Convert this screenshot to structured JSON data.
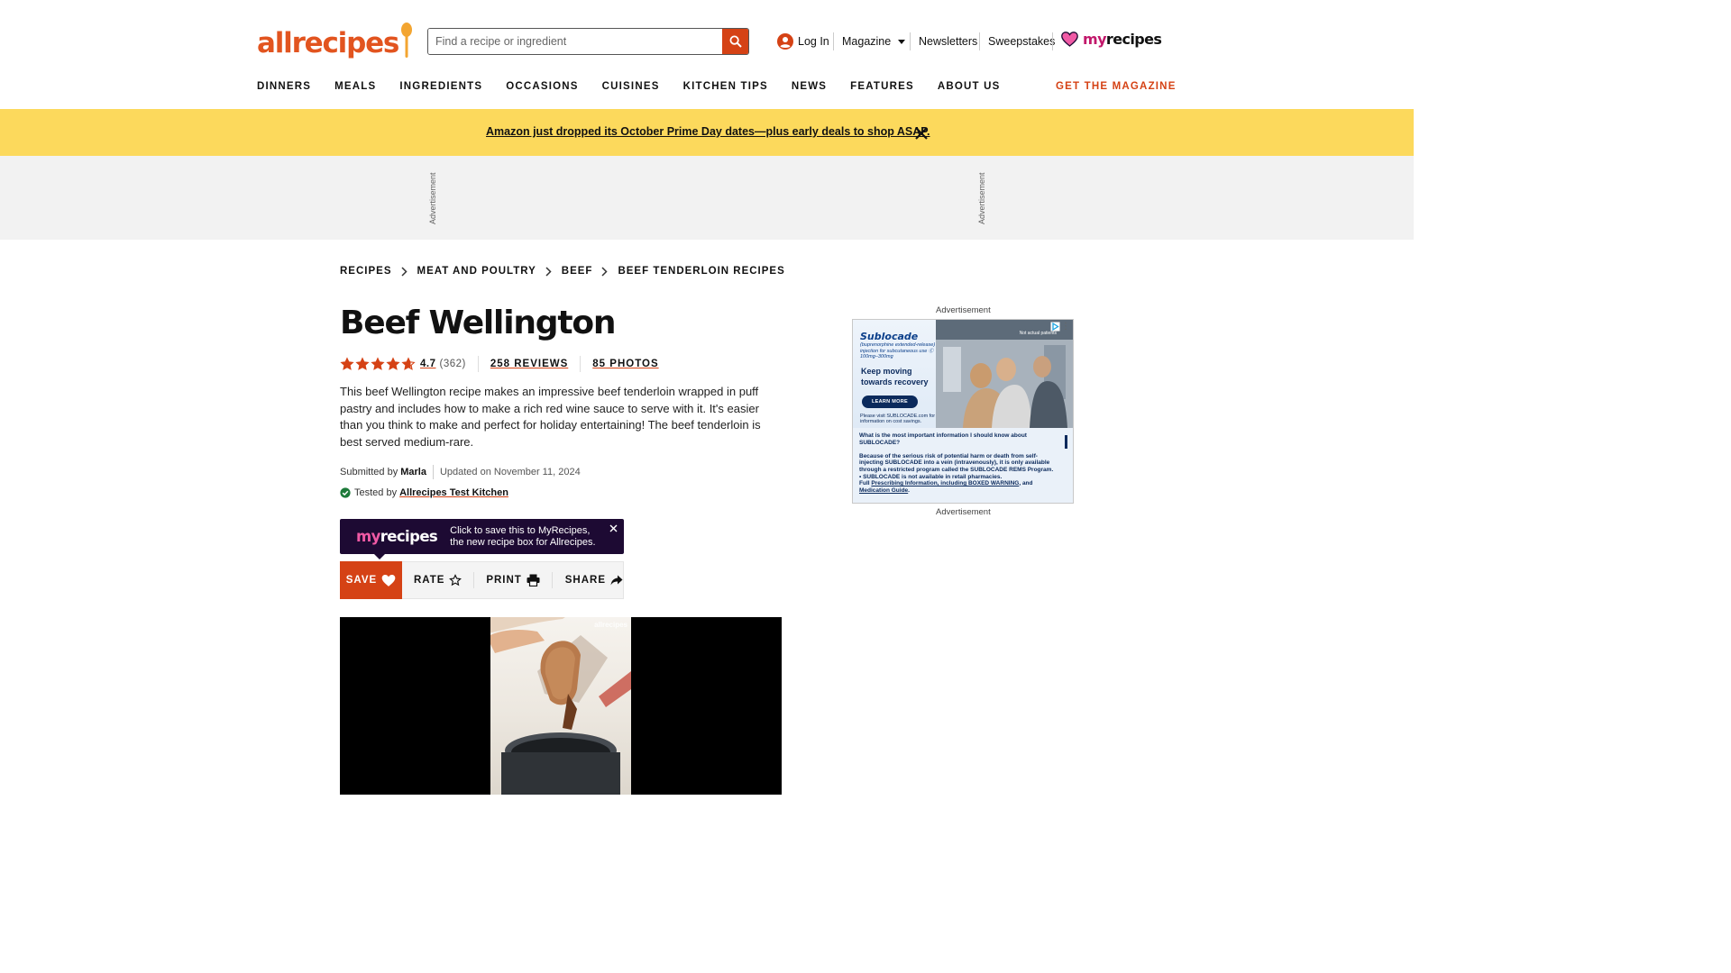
{
  "header": {
    "logo": "allrecipes",
    "search_placeholder": "Find a recipe or ingredient",
    "login": "Log In",
    "magazine": "Magazine",
    "newsletters": "Newsletters",
    "sweepstakes": "Sweepstakes",
    "myrecipes_my": "my",
    "myrecipes_recipes": "recipes",
    "nav": [
      "DINNERS",
      "MEALS",
      "INGREDIENTS",
      "OCCASIONS",
      "CUISINES",
      "KITCHEN TIPS",
      "NEWS",
      "FEATURES",
      "ABOUT US"
    ],
    "get_magazine": "GET THE MAGAZINE"
  },
  "promo": {
    "text": "Amazon just dropped its October Prime Day dates—plus early deals to shop ASAP."
  },
  "ad_band": {
    "label": "Advertisement"
  },
  "breadcrumb": [
    "RECIPES",
    "MEAT AND POULTRY",
    "BEEF",
    "BEEF TENDERLOIN RECIPES"
  ],
  "recipe": {
    "title": "Beef Wellington",
    "rating": "4.7",
    "rating_value": 4.7,
    "rating_count": "(362)",
    "reviews": "258 REVIEWS",
    "photos": "85 PHOTOS",
    "description": "This beef Wellington recipe makes an impressive beef tenderloin wrapped in puff pastry and includes how to make a rich red wine sauce to serve with it. It's easier than you think to make and perfect for holiday entertaining! The beef tenderloin is best served medium-rare.",
    "submitted_by_label": "Submitted by",
    "author": "Marla",
    "updated": "Updated on November 11, 2024",
    "tested_by_label": "Tested by",
    "tested_by": "Allrecipes Test Kitchen"
  },
  "myrecipes_tip": {
    "logo_my": "my",
    "logo_recipes": "recipes",
    "line1": "Click to save this to MyRecipes,",
    "line2": "the new recipe box for Allrecipes."
  },
  "actions": {
    "save": "SAVE",
    "rate": "RATE",
    "print": "PRINT",
    "share": "SHARE"
  },
  "video": {
    "watermark": "allrecipes"
  },
  "sidebar_ad": {
    "label_top": "Advertisement",
    "label_bottom": "Advertisement",
    "brand": "Sublocade",
    "brand_sub": "(buprenorphine extended-release) injection for subcutaneous use Ⓒ 100mg–300mg",
    "headline": "Keep moving towards recovery",
    "button": "LEARN MORE",
    "visit": "Please visit SUBLOCADE.com for information on cost savings.",
    "note": "Not actual patients",
    "isi_q": "What is the most important information I should know about SUBLOCADE?",
    "isi_1": "Because of the serious risk of potential harm or death from self-injecting SUBLOCADE into a vein (intravenously), it is only available through a restricted program called the SUBLOCADE REMS Program.",
    "isi_2": "• SUBLOCADE is not available in retail pharmacies.",
    "isi_3_pre": "Full ",
    "isi_3_link": "Prescribing Information, including BOXED WARNING",
    "isi_3_mid": ", and ",
    "isi_3_link2": "Medication Guide",
    "isi_3_end": "."
  },
  "colors": {
    "brand_orange": "#d54215",
    "promo_yellow": "#fcd95c",
    "myrecipes_purple": "#1d0a33",
    "myrecipes_pink": "#c2186b",
    "star": "#d54215"
  },
  "icons": [
    "search-icon",
    "user-icon",
    "caret-down-icon",
    "heart-icon",
    "close-icon",
    "chevron-right-icon",
    "star-icon",
    "check-badge-icon",
    "print-icon",
    "share-icon",
    "adchoices-icon"
  ]
}
